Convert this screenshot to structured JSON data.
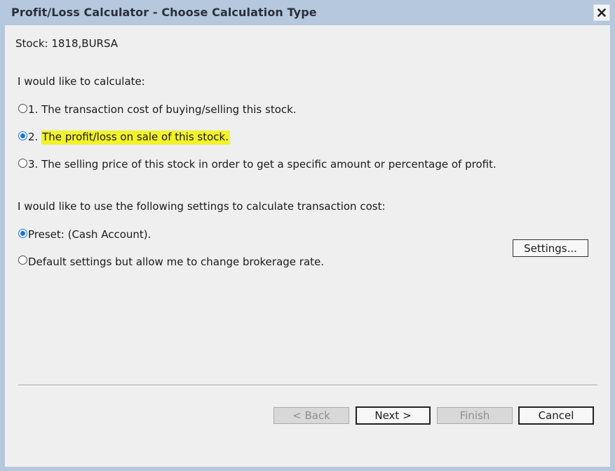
{
  "window": {
    "title": "Profit/Loss Calculator - Choose Calculation Type",
    "close_icon": "close-icon"
  },
  "stock": {
    "label": "Stock: 1818,BURSA"
  },
  "calc_type": {
    "heading": "I would like to calculate:",
    "options": [
      {
        "label": "1. The transaction cost of buying/selling this stock.",
        "selected": false
      },
      {
        "label": "The profit/loss on sale of this stock.",
        "prefix": "2. ",
        "selected": true,
        "highlighted": true
      },
      {
        "label": "3. The selling price of this stock in order to get a specific amount or percentage of profit.",
        "selected": false
      }
    ]
  },
  "settings": {
    "heading": "I would like to use the following settings to calculate transaction cost:",
    "options": [
      {
        "label": "Preset: (Cash Account).",
        "selected": true
      },
      {
        "label": "Default settings but allow me to change brokerage rate.",
        "selected": false
      }
    ],
    "settings_button": "Settings..."
  },
  "footer": {
    "back": "< Back",
    "next": "Next >",
    "finish": "Finish",
    "cancel": "Cancel"
  },
  "colors": {
    "accent": "#1a73d9",
    "highlight": "#f2f22a",
    "frame": "#b6c8dd"
  }
}
